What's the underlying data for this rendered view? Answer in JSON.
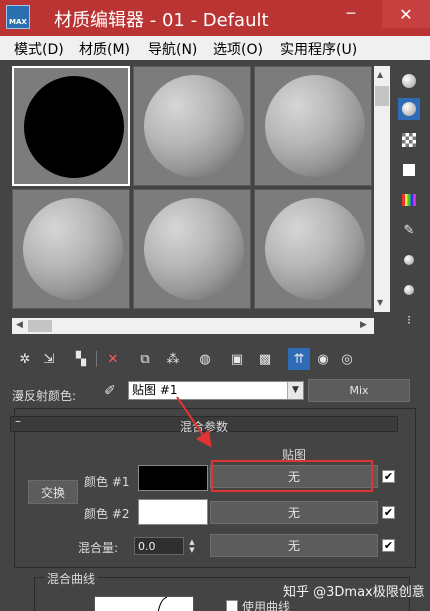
{
  "window": {
    "title": "材质编辑器 - 01 - Default",
    "app_icon_label": "MAX",
    "minimize": "─",
    "close": "✕"
  },
  "menu": [
    "模式(D)",
    "材质(M)",
    "导航(N)",
    "选项(O)",
    "实用程序(U)"
  ],
  "sample_slots": [
    {
      "id": "slot-1",
      "style": "black",
      "selected": true
    },
    {
      "id": "slot-2",
      "style": "gray"
    },
    {
      "id": "slot-3",
      "style": "gray"
    },
    {
      "id": "slot-4",
      "style": "gray"
    },
    {
      "id": "slot-5",
      "style": "gray"
    },
    {
      "id": "slot-6",
      "style": "gray"
    }
  ],
  "diffuse": {
    "label": "漫反射颜色:",
    "map_select": "贴图 #1",
    "type_button": "Mix"
  },
  "rollout": {
    "minus": "–",
    "title": "混合参数"
  },
  "mix_params": {
    "map_column_header": "贴图",
    "swap_button": "交换",
    "color1_label": "颜色 #1",
    "color1_value": "#000000",
    "color1_map": "无",
    "color2_label": "颜色 #2",
    "color2_value": "#ffffff",
    "color2_map": "无",
    "mix_amount_label": "混合量:",
    "mix_amount_value": "0.0",
    "mix_map": "无",
    "checkmark": "✔"
  },
  "mix_curve": {
    "title": "混合曲线",
    "use_curve_label": "使用曲线"
  },
  "watermark": "知乎 @3Dmax极限创意",
  "colors": {
    "titlebar": "#bb3434",
    "panel_bg": "#444444",
    "highlight": "#e03333",
    "active_tool": "#2f6cb8"
  }
}
